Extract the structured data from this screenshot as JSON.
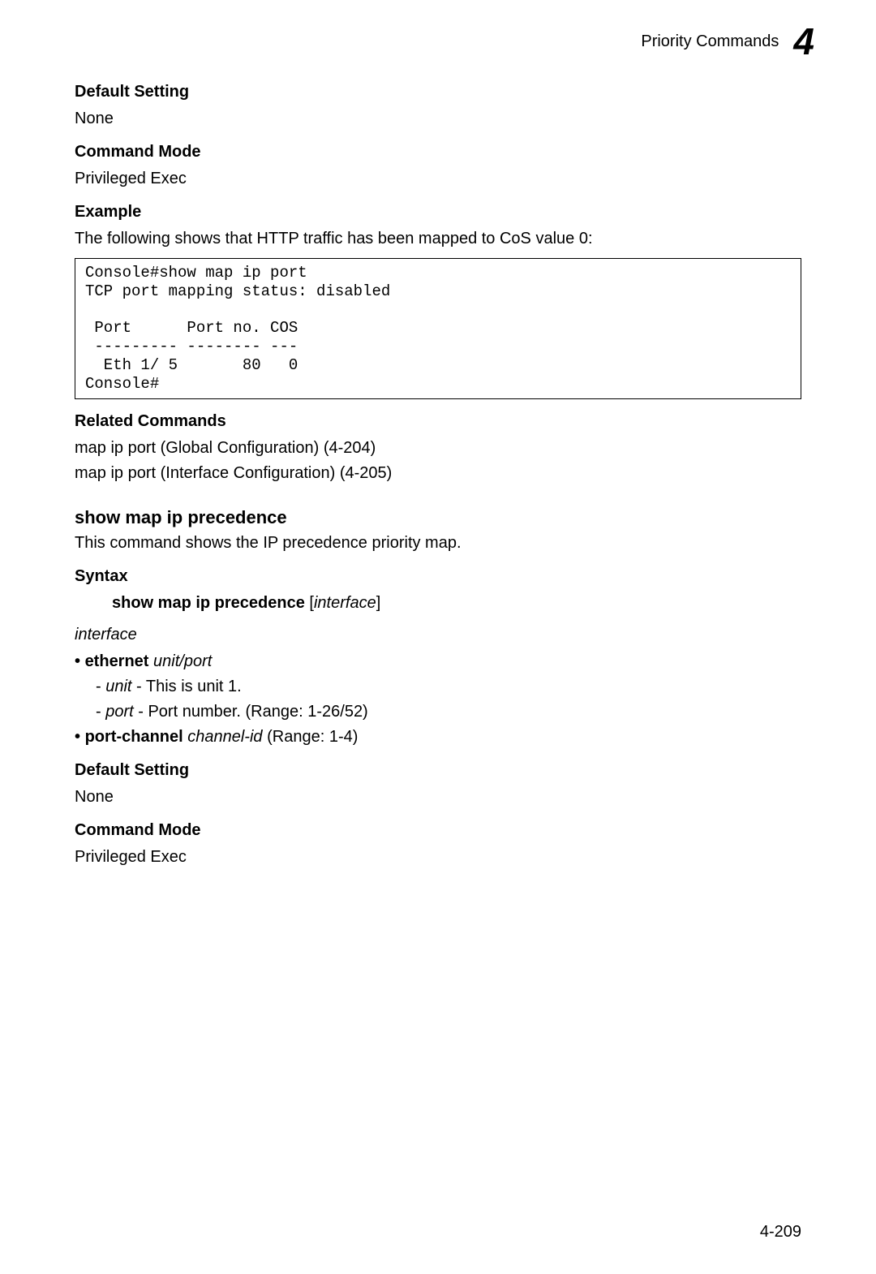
{
  "header": {
    "section_title": "Priority Commands",
    "chapter_num": "4"
  },
  "sec1": {
    "default_setting_h": "Default Setting",
    "default_setting_body": "None",
    "command_mode_h": "Command Mode",
    "command_mode_body": "Privileged Exec",
    "example_h": "Example",
    "example_intro": "The following shows that  HTTP traffic has been mapped  to CoS value 0:",
    "code": "Console#show map ip port\nTCP port mapping status: disabled\n\n Port      Port no. COS\n --------- -------- ---\n  Eth 1/ 5       80   0\nConsole#",
    "related_h": "Related Commands",
    "related_1": "map ip port (Global Configuration) (4-204)",
    "related_2": "map ip port (Interface Configuration) (4-205)"
  },
  "sec2": {
    "cmd_name": "show map ip precedence",
    "desc": "This command shows the IP precedence priority map.",
    "syntax_h": "Syntax",
    "syntax_bold": "show map ip precedence",
    "syntax_rest": "[interface]",
    "interface_word": "interface",
    "eth_bold": "ethernet",
    "eth_ital": "unit/port",
    "unit_ital": "unit",
    "unit_rest": " - This is unit 1.",
    "port_ital": "port",
    "port_rest": " - Port number. (Range: 1-26/52)",
    "pc_bold": "port-channel",
    "pc_ital": "channel-id",
    "pc_rest": " (Range: 1-4)",
    "default_setting_h": "Default Setting",
    "default_setting_body": "None",
    "command_mode_h": "Command Mode",
    "command_mode_body": "Privileged Exec"
  },
  "footer": {
    "page_num": "4-209"
  }
}
